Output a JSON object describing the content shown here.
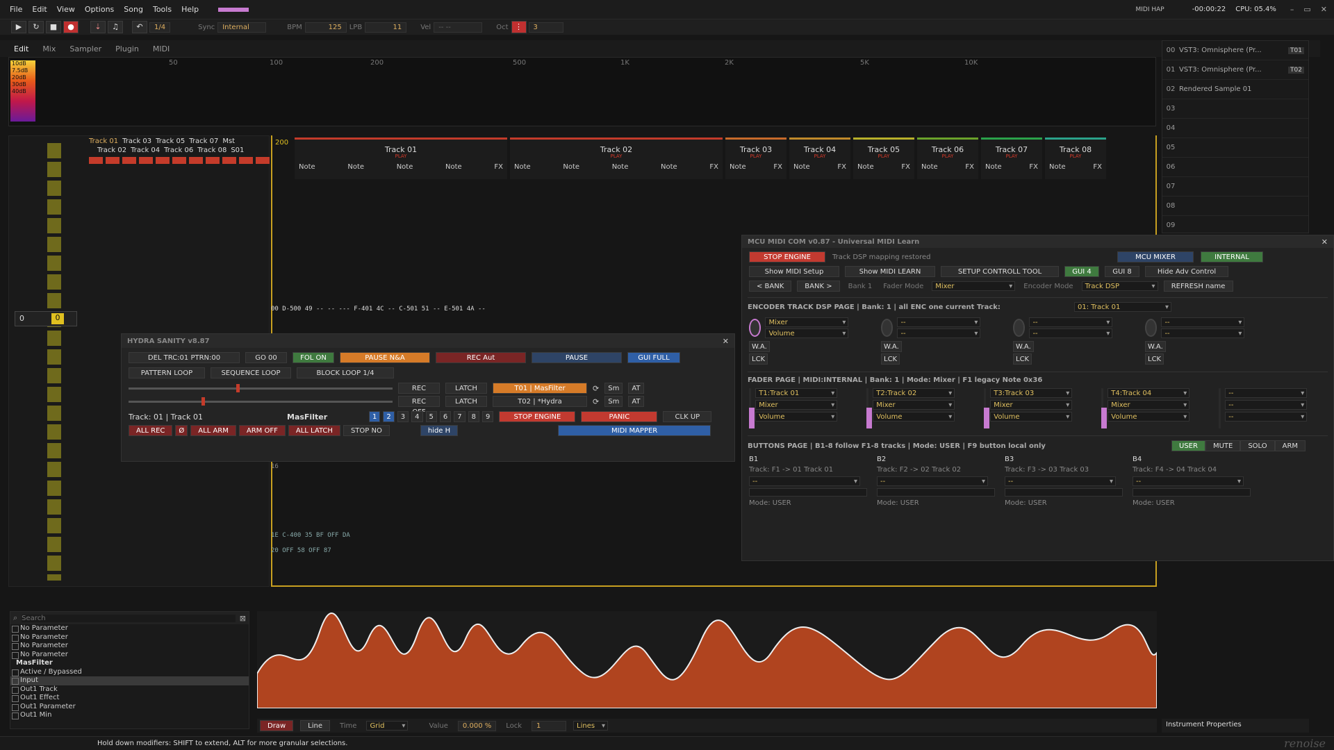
{
  "menu": [
    "File",
    "Edit",
    "View",
    "Options",
    "Song",
    "Tools",
    "Help"
  ],
  "top_right": {
    "midi_label": "MIDI HAP",
    "time": "-00:00:22",
    "cpu": "CPU: 05.4%"
  },
  "transport": {
    "step": "1/4",
    "sync_label": "Sync",
    "sync_value": "Internal",
    "bpm_label": "BPM",
    "bpm": "125",
    "lpb_label": "LPB",
    "lpb": "11",
    "vel_label": "Vel",
    "vel": "-- --",
    "oct_label": "Oct",
    "oct": "3"
  },
  "tabs": [
    "Edit",
    "Mix",
    "Sampler",
    "Plugin",
    "MIDI"
  ],
  "spectrum": {
    "levels": [
      "10dB",
      "7.5dB",
      "20dB",
      "30dB",
      "40dB"
    ],
    "freqs": [
      "50",
      "100",
      "200",
      "500",
      "1K",
      "2K",
      "5K",
      "10K"
    ]
  },
  "instruments": [
    {
      "num": "00",
      "name": "VST3: Omnisphere (Pr...",
      "tag": "T01"
    },
    {
      "num": "01",
      "name": "VST3: Omnisphere (Pr...",
      "tag": "T02"
    },
    {
      "num": "02",
      "name": "Rendered Sample 01",
      "tag": ""
    },
    {
      "num": "03",
      "name": "",
      "tag": ""
    },
    {
      "num": "04",
      "name": "",
      "tag": ""
    },
    {
      "num": "05",
      "name": "",
      "tag": ""
    },
    {
      "num": "06",
      "name": "",
      "tag": ""
    },
    {
      "num": "07",
      "name": "",
      "tag": ""
    },
    {
      "num": "08",
      "name": "",
      "tag": ""
    },
    {
      "num": "09",
      "name": "",
      "tag": ""
    }
  ],
  "track_list": {
    "row1": [
      "Track 01",
      "Track 03",
      "Track 05",
      "Track 07",
      "Mst"
    ],
    "row2": [
      "Track 02",
      "Track 04",
      "Track 06",
      "Track 08",
      "S01"
    ]
  },
  "pattern": {
    "pattern_num": "200",
    "tracks": [
      {
        "name": "Track 01",
        "color": "#c43b2a",
        "cols": [
          "Note",
          "Note",
          "Note",
          "Note",
          "FX"
        ]
      },
      {
        "name": "Track 02",
        "color": "#c43b2a",
        "cols": [
          "Note",
          "Note",
          "Note",
          "Note",
          "FX"
        ]
      },
      {
        "name": "Track 03",
        "color": "#c76a2a",
        "cols": [
          "Note",
          "FX"
        ]
      },
      {
        "name": "Track 04",
        "color": "#c08a2a",
        "cols": [
          "Note",
          "FX"
        ]
      },
      {
        "name": "Track 05",
        "color": "#b8b02a",
        "cols": [
          "Note",
          "FX"
        ]
      },
      {
        "name": "Track 06",
        "color": "#6aa22a",
        "cols": [
          "Note",
          "FX"
        ]
      },
      {
        "name": "Track 07",
        "color": "#2aa24a",
        "cols": [
          "Note",
          "FX"
        ]
      },
      {
        "name": "Track 08",
        "color": "#2aa28a",
        "cols": [
          "Note",
          "FX"
        ]
      }
    ],
    "play_label": "PLAY",
    "line00": "00  D-500 49 --     -- ---      F-401 4C -- C-501 51 -- E-501 4A --",
    "line16": "16",
    "line1e": "1E       C-400 35 BF      OFF   DA",
    "line20": "20                               OFF   58 OFF   87"
  },
  "hydra": {
    "title": "HYDRA SANITY v8.87",
    "del_trc": "DEL TRC:01 PTRN:00",
    "go00": "GO 00",
    "fol_on": "FOL ON",
    "pause_na": "PAUSE N&A",
    "rec_aut": "REC Aut",
    "pause": "PAUSE",
    "gui_full": "GUI FULL",
    "pattern_loop": "PATTERN LOOP",
    "sequence_loop": "SEQUENCE LOOP",
    "block_loop": "BLOCK LOOP 1/4",
    "rec_off_1": "REC OFF",
    "latch_1": "LATCH",
    "t01": "T01 | MasFilter",
    "sm_1": "Sm",
    "at_1": "AT",
    "rec_off_2": "REC OFF",
    "latch_2": "LATCH",
    "t02": "T02 | *Hydra",
    "sm_2": "Sm",
    "at_2": "AT",
    "track_label": "Track: 01 | Track 01",
    "masfilter": "MasFilter",
    "nums": [
      "1",
      "2",
      "3",
      "4",
      "5",
      "6",
      "7",
      "8",
      "9"
    ],
    "stop_engine": "STOP ENGINE",
    "panic": "PANIC",
    "clk_up": "CLK UP",
    "all_rec": "ALL REC",
    "null": "Ø",
    "all_arm": "ALL ARM",
    "arm_off": "ARM OFF",
    "all_latch": "ALL LATCH",
    "stop_no": "STOP NO",
    "hide_h": "hide H",
    "midi_mapper": "MIDI MAPPER"
  },
  "mcu": {
    "title": "MCU MIDI COM v0.87 - Universal MIDI Learn",
    "stop_engine": "STOP ENGINE",
    "status": "Track DSP mapping restored",
    "mcu_mixer": "MCU MIXER",
    "internal": "INTERNAL",
    "show_midi_setup": "Show MIDI Setup",
    "show_midi_learn": "Show MIDI LEARN",
    "setup_tool": "SETUP CONTROLL TOOL",
    "gui4": "GUI 4",
    "gui8": "GUI 8",
    "hide_adv": "Hide Adv Control",
    "bank_prev": "< BANK",
    "bank_next": "BANK >",
    "bank": "Bank 1",
    "fader_mode_label": "Fader Mode",
    "fader_mode": "Mixer",
    "encoder_mode_label": "Encoder Mode",
    "encoder_mode": "Track DSP",
    "refresh": "REFRESH name",
    "encoder_title": "ENCODER TRACK DSP PAGE | Bank: 1 | all ENC one current Track:",
    "encoder_track": "01: Track 01",
    "enc": [
      {
        "a": "Mixer",
        "b": "Volume"
      },
      {
        "a": "--",
        "b": "--"
      },
      {
        "a": "--",
        "b": "--"
      },
      {
        "a": "--",
        "b": "--"
      }
    ],
    "wa": "W.A.",
    "lck": "LCK",
    "fader_title": "FADER PAGE | MIDI:INTERNAL | Bank: 1 | Mode: Mixer | F1 legacy Note 0x36",
    "faders": [
      {
        "track": "T1:Track 01",
        "a": "Mixer",
        "b": "Volume"
      },
      {
        "track": "T2:Track 02",
        "a": "Mixer",
        "b": "Volume"
      },
      {
        "track": "T3:Track 03",
        "a": "Mixer",
        "b": "Volume"
      },
      {
        "track": "T4:Track 04",
        "a": "Mixer",
        "b": "Volume"
      },
      {
        "track": "--",
        "a": "--",
        "b": "--"
      }
    ],
    "buttons_title": "BUTTONS PAGE | B1-8 follow F1-8 tracks | Mode: USER | F9 button local only",
    "user": "USER",
    "mute": "MUTE",
    "solo": "SOLO",
    "arm": "ARM",
    "bpage": [
      {
        "name": "B1",
        "track": "Track: F1 -> 01 Track 01",
        "mode": "Mode: USER"
      },
      {
        "name": "B2",
        "track": "Track: F2 -> 02 Track 02",
        "mode": "Mode: USER"
      },
      {
        "name": "B3",
        "track": "Track: F3 -> 03 Track 03",
        "mode": "Mode: USER"
      },
      {
        "name": "B4",
        "track": "Track: F4 -> 04 Track 04",
        "mode": "Mode: USER"
      }
    ]
  },
  "params": {
    "search_placeholder": "Search",
    "items": [
      "No Parameter",
      "No Parameter",
      "No Parameter",
      "No Parameter"
    ],
    "group": "MasFilter",
    "sub": [
      "Active / Bypassed",
      "Input",
      "Out1 Track",
      "Out1 Effect",
      "Out1 Parameter",
      "Out1 Min"
    ]
  },
  "auto_tools": {
    "draw": "Draw",
    "line": "Line",
    "time": "Time",
    "grid": "Grid",
    "value": "Value",
    "value_num": "0.000 %",
    "lock": "Lock",
    "lock_val": "1",
    "lines": "Lines",
    "inst_props": "Instrument Properties"
  },
  "status": "Hold down modifiers: SHIFT to extend, ALT for more granular selections.",
  "brand": "renoise"
}
